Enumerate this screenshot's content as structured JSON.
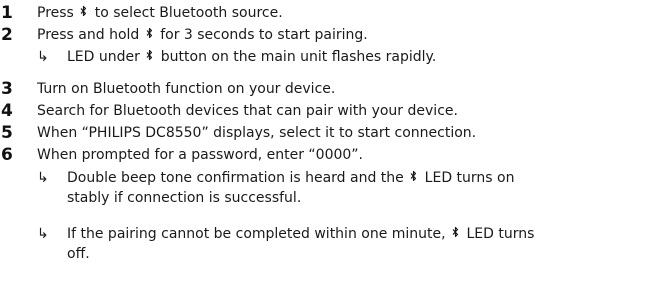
{
  "steps": [
    {
      "num": "1",
      "a": "Press ",
      "b": " to select Bluetooth source."
    },
    {
      "num": "2",
      "a": "Press and hold ",
      "b": " for 3 seconds to start pairing."
    },
    {
      "num": "3",
      "text": "Turn on Bluetooth function on your device."
    },
    {
      "num": "4",
      "text": "Search for Bluetooth devices that can pair with your device."
    },
    {
      "num": "5",
      "text": "When “PHILIPS DC8550” displays, select it to start connection."
    },
    {
      "num": "6",
      "text": "When prompted for a password, enter “0000”."
    }
  ],
  "arrow_symbol": "↳",
  "sub_2": {
    "a": "LED under ",
    "b": " button on the main unit flashes rapidly."
  },
  "sub_6a": {
    "a": "Double beep tone confirmation is heard and the ",
    "b": " LED turns on",
    "c": "stably if connection is successful."
  },
  "sub_6b": {
    "a": "If the pairing cannot be completed within one minute, ",
    "b": " LED turns",
    "c": "off."
  },
  "icon_color": "#1a1a1a"
}
